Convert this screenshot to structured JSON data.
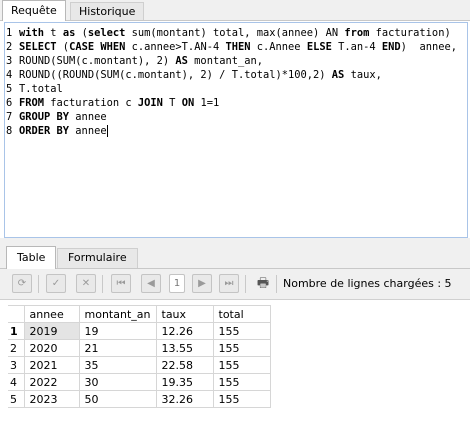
{
  "top_tabs": [
    "Requête",
    "Historique"
  ],
  "editor": {
    "lines": [
      {
        "n": "1",
        "parts": [
          {
            "t": "with",
            "kw": true
          },
          {
            "t": " t ",
            "kw": false
          },
          {
            "t": "as",
            "kw": true
          },
          {
            "t": " (",
            "kw": false
          },
          {
            "t": "select",
            "kw": true
          },
          {
            "t": " sum(montant) total, max(annee) AN ",
            "kw": false
          },
          {
            "t": "from",
            "kw": true
          },
          {
            "t": " facturation)",
            "kw": false
          }
        ]
      },
      {
        "n": "2",
        "parts": [
          {
            "t": "SELECT",
            "kw": true
          },
          {
            "t": " (",
            "kw": false
          },
          {
            "t": "CASE WHEN",
            "kw": true
          },
          {
            "t": " c.annee>T.AN-4 ",
            "kw": false
          },
          {
            "t": "THEN",
            "kw": true
          },
          {
            "t": " c.Annee ",
            "kw": false
          },
          {
            "t": "ELSE",
            "kw": true
          },
          {
            "t": " T.an-4 ",
            "kw": false
          },
          {
            "t": "END",
            "kw": true
          },
          {
            "t": ")  annee,",
            "kw": false
          }
        ]
      },
      {
        "n": "3",
        "parts": [
          {
            "t": "ROUND(SUM(c.montant), 2) ",
            "kw": false
          },
          {
            "t": "AS",
            "kw": true
          },
          {
            "t": " montant_an,",
            "kw": false
          }
        ]
      },
      {
        "n": "4",
        "parts": [
          {
            "t": "ROUND((ROUND(SUM(c.montant), 2) / T.total)*100,2) ",
            "kw": false
          },
          {
            "t": "AS",
            "kw": true
          },
          {
            "t": " taux,",
            "kw": false
          }
        ]
      },
      {
        "n": "5",
        "parts": [
          {
            "t": "T.total",
            "kw": false
          }
        ]
      },
      {
        "n": "6",
        "parts": [
          {
            "t": "FROM",
            "kw": true
          },
          {
            "t": " facturation c ",
            "kw": false
          },
          {
            "t": "JOIN",
            "kw": true
          },
          {
            "t": " T ",
            "kw": false
          },
          {
            "t": "ON",
            "kw": true
          },
          {
            "t": " 1=1",
            "kw": false
          }
        ]
      },
      {
        "n": "7",
        "parts": [
          {
            "t": "GROUP BY",
            "kw": true
          },
          {
            "t": " annee",
            "kw": false
          }
        ]
      },
      {
        "n": "8",
        "parts": [
          {
            "t": "ORDER BY",
            "kw": true
          },
          {
            "t": " annee",
            "kw": false
          }
        ]
      }
    ]
  },
  "bottom_tabs": [
    "Table",
    "Formulaire"
  ],
  "toolbar": {
    "buttons": [
      {
        "name": "refresh-button",
        "icon": "refresh-icon",
        "glyph": "⟳",
        "style": "blue",
        "enabled": true
      },
      {
        "name": "apply-button",
        "icon": "checkmark-icon",
        "glyph": "✓",
        "style": "grey",
        "enabled": false
      },
      {
        "name": "cancel-button",
        "icon": "close-icon",
        "glyph": "✕",
        "style": "grey",
        "enabled": false
      },
      {
        "name": "first-page-button",
        "icon": "first-page-icon",
        "glyph": "⏮",
        "style": "grey",
        "enabled": false
      },
      {
        "name": "prev-page-button",
        "icon": "previous-page-icon",
        "glyph": "◀",
        "style": "grey",
        "enabled": false
      },
      {
        "name": "next-page-button",
        "icon": "next-page-icon",
        "glyph": "▶",
        "style": "grey",
        "enabled": false
      },
      {
        "name": "last-page-button",
        "icon": "last-page-icon",
        "glyph": "⏭",
        "style": "grey",
        "enabled": false
      },
      {
        "name": "print-button",
        "icon": "printer-icon",
        "glyph": "🖶",
        "style": "grey",
        "enabled": true
      }
    ],
    "page_number": "1",
    "row_count_label": "Nombre de lignes chargées : 5"
  },
  "table": {
    "columns": [
      "annee",
      "montant_an",
      "taux",
      "total"
    ],
    "rows": [
      {
        "num": "1",
        "cells": [
          "2019",
          "19",
          "12.26",
          "155"
        ]
      },
      {
        "num": "2",
        "cells": [
          "2020",
          "21",
          "13.55",
          "155"
        ]
      },
      {
        "num": "3",
        "cells": [
          "2021",
          "35",
          "22.58",
          "155"
        ]
      },
      {
        "num": "4",
        "cells": [
          "2022",
          "30",
          "19.35",
          "155"
        ]
      },
      {
        "num": "5",
        "cells": [
          "2023",
          "50",
          "32.26",
          "155"
        ]
      }
    ]
  },
  "colors": {
    "accent": "#3b7bd4",
    "editor_border": "#a9c4e8",
    "selected_cell": "#e4e4e4"
  }
}
